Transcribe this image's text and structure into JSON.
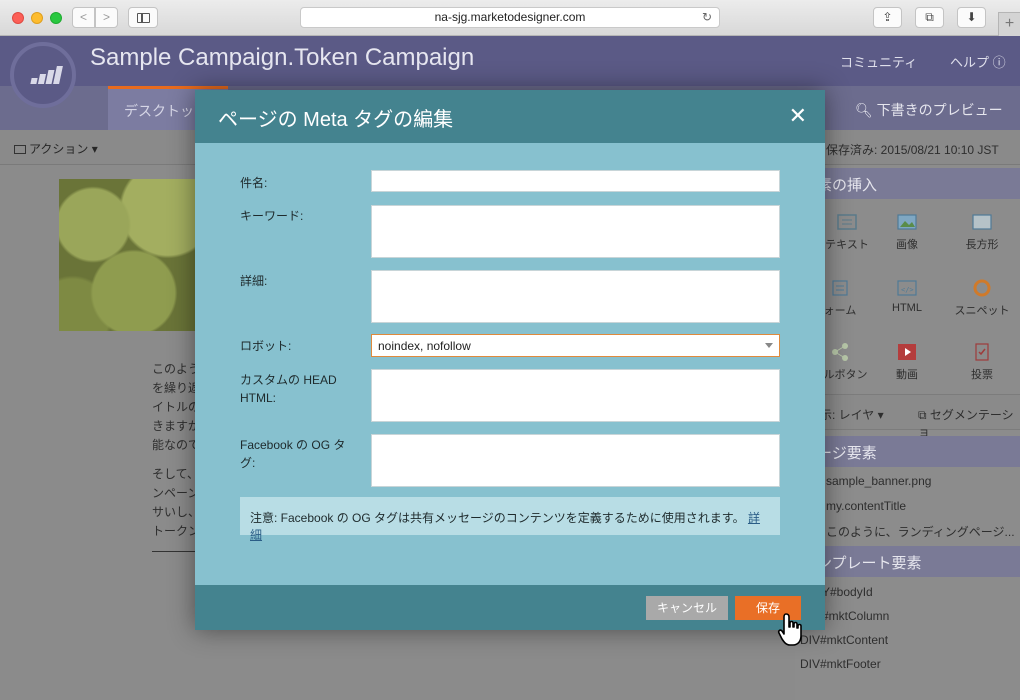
{
  "browser": {
    "url": "na-sjg.marketodesigner.com",
    "back_glyph": "<",
    "forward_glyph": ">",
    "reload_glyph": "↻",
    "share_glyph": "⇪",
    "tabs_glyph": "⧉",
    "download_glyph": "⬇",
    "new_tab_glyph": "+"
  },
  "app": {
    "title": "Sample Campaign.Token Campaign",
    "header_links": [
      "コミュニティ",
      "ヘルプ ⓘ"
    ],
    "tab_desktop": "デスクトッ",
    "preview_label": "下書きのプレビュー",
    "action_menu": "アクション ▾",
    "saved_status": "保存済み: 2015/08/21 10:10 JST",
    "body_lines_1": [
      "このよう",
      "を繰り返",
      "イトルの",
      "きますが",
      "能なので"
    ],
    "body_lines_2": [
      "そして、",
      "ンペーン",
      "サいし、",
      "トークン"
    ]
  },
  "right_panel": {
    "insert_heading": "素の挿入",
    "palette": [
      {
        "label": "テキスト",
        "icon": "text-icon"
      },
      {
        "label": "画像",
        "icon": "image-icon"
      },
      {
        "label": "長方形",
        "icon": "rectangle-icon"
      },
      {
        "label": "ォーム",
        "icon": "form-icon"
      },
      {
        "label": "HTML",
        "icon": "html-icon"
      },
      {
        "label": "スニペット",
        "icon": "snippet-icon"
      },
      {
        "label": "ャルボタン",
        "icon": "share-icon"
      },
      {
        "label": "動画",
        "icon": "video-icon"
      },
      {
        "label": "投票",
        "icon": "poll-icon"
      }
    ],
    "layer_label": "示: レイヤ ▾",
    "segment_label": "セグメンテーショ",
    "page_elements_heading": "ージ要素",
    "page_elements": [
      "sample_banner.png",
      "my.contentTitle",
      "このように、ランディングページ..."
    ],
    "template_elements_heading": "ンプレート要素",
    "template_elements": [
      "Y#bodyId",
      "#mktColumn",
      "DIV#mktContent",
      "DIV#mktFooter"
    ]
  },
  "modal": {
    "title": "ページの Meta タグの編集",
    "close_glyph": "✕",
    "fields": {
      "subject_label": "件名:",
      "subject_value": "",
      "keywords_label": "キーワード:",
      "keywords_value": "",
      "details_label": "詳細:",
      "details_value": "",
      "robots_label": "ロボット:",
      "robots_value": "noindex, nofollow",
      "custom_head_label_1": "カスタムの HEAD",
      "custom_head_label_2": "HTML:",
      "custom_head_value": "",
      "og_label_1": "Facebook の OG タ",
      "og_label_2": "グ:",
      "og_value": ""
    },
    "note_text": "注意: Facebook の OG タグは共有メッセージのコンテンツを定義するために使用されます。",
    "note_link": "詳細",
    "cancel_label": "キャンセル",
    "save_label": "保存"
  },
  "colors": {
    "modal_header": "#44838f",
    "modal_body": "#87c1cf",
    "save_button": "#e96f26",
    "cancel_button": "#a9a9a9",
    "marketo_header": "#5b5a86"
  }
}
